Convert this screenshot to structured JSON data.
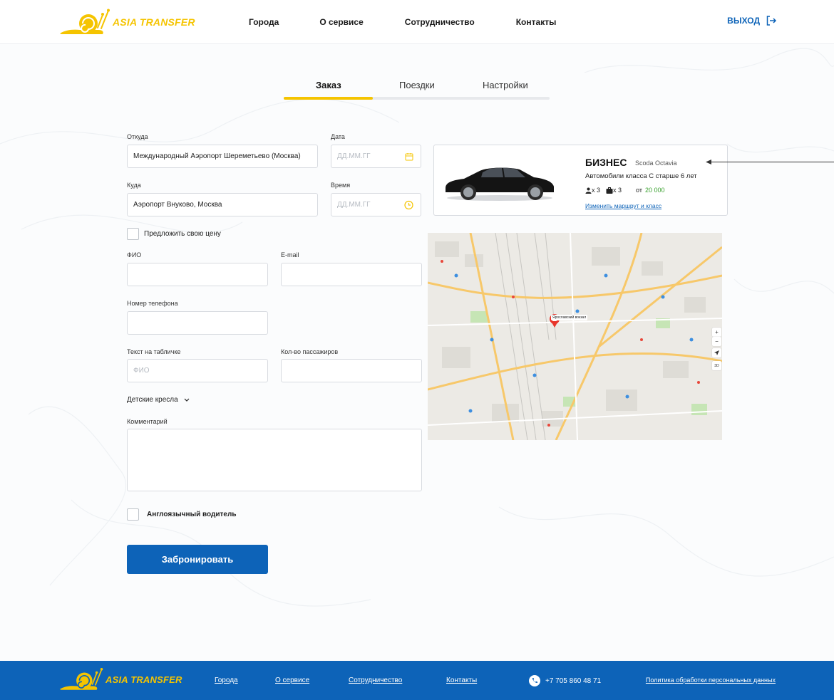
{
  "brand": {
    "name": "ASIA TRANSFER",
    "color": "#f5c400"
  },
  "header": {
    "nav": [
      "Города",
      "О сервисе",
      "Сотрудничество",
      "Контакты"
    ],
    "logout_label": "ВЫХОД"
  },
  "tabs": [
    {
      "label": "Заказ",
      "active": true
    },
    {
      "label": "Поездки",
      "active": false
    },
    {
      "label": "Настройки",
      "active": false
    }
  ],
  "form": {
    "from_label": "Откуда",
    "from_value": "Международный Аэропорт Шереметьево (Москва)",
    "date_label": "Дата",
    "date_placeholder": "ДД.ММ.ГГ",
    "to_label": "Куда",
    "to_value": "Аэропорт Внуково, Москва",
    "time_label": "Время",
    "time_placeholder": "ДД.ММ.ГГ",
    "offer_price_label": "Предложить свою цену",
    "name_label": "ФИО",
    "email_label": "E-mail",
    "phone_label": "Номер телефона",
    "sign_label": "Текст на табличке",
    "sign_placeholder": "ФИО",
    "passengers_label": "Кол-во пассажиров",
    "child_seats_label": "Детские кресла",
    "comment_label": "Комментарий",
    "english_driver_label": "Англоязычный водитель",
    "submit_label": "Забронировать"
  },
  "car": {
    "class": "БИЗНЕС",
    "model": "Scoda Octavia",
    "description": "Автомобили класса С старше 6 лет",
    "passengers": "x 3",
    "luggage": "x 3",
    "price_prefix": "от",
    "price": "20 000",
    "change_link": "Изменить маршрут и класс"
  },
  "map": {
    "marker_label": "Ярославский вокзал",
    "zoom_in": "+",
    "zoom_out": "−",
    "mode": "3D"
  },
  "footer": {
    "nav": [
      "Города",
      "О сервисе",
      "Сотрудничество",
      "Контакты"
    ],
    "phone": "+7 705 860 48 71",
    "policy": "Политика обработки персональных данных"
  },
  "colors": {
    "accent": "#f5c400",
    "primary": "#0d63b8",
    "price": "#3aa12f"
  }
}
